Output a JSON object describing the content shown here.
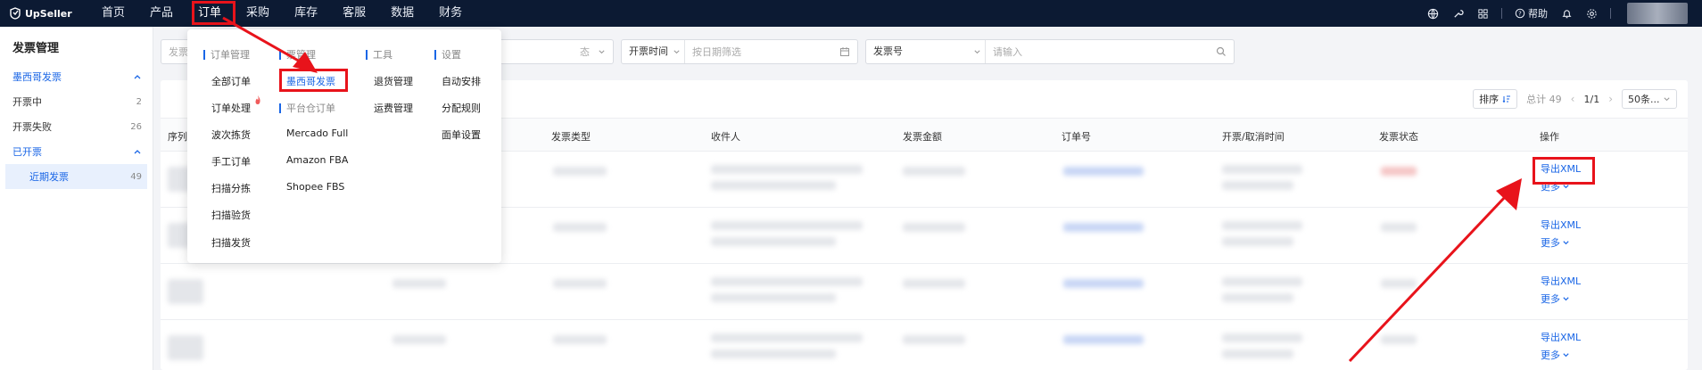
{
  "app": {
    "brand": "UpSeller"
  },
  "nav": {
    "items": [
      "首页",
      "产品",
      "订单",
      "采购",
      "库存",
      "客服",
      "数据",
      "财务"
    ],
    "active": "订单",
    "help": "帮助"
  },
  "sidebar": {
    "title": "发票管理",
    "group1": {
      "label": "墨西哥发票"
    },
    "items": [
      {
        "label": "开票中",
        "count": "2"
      },
      {
        "label": "开票失败",
        "count": "26"
      }
    ],
    "group2": {
      "label": "已开票"
    },
    "sub": {
      "label": "近期发票",
      "count": "49"
    }
  },
  "filters": {
    "box1": "发票",
    "box2_suffix": "态",
    "time_label": "开票时间",
    "date_placeholder": "按日期筛选",
    "invoice_label": "发票号",
    "search_placeholder": "请输入"
  },
  "toolbar": {
    "sort": "排序",
    "total": "总计 49",
    "page": "1/1",
    "per_page": "50条..."
  },
  "table": {
    "headers": {
      "seq": "序列",
      "type": "发票类型",
      "recipient": "收件人",
      "amount": "发票金额",
      "order": "订单号",
      "time": "开票/取消时间",
      "status": "发票状态",
      "ops": "操作"
    },
    "rows": [
      {
        "export": "导出XML",
        "more": "更多"
      },
      {
        "export": "导出XML",
        "more": "更多"
      },
      {
        "export": "导出XML",
        "more": "更多"
      },
      {
        "export": "导出XML",
        "more": "更多"
      }
    ]
  },
  "menu": {
    "col1": {
      "head": "订单管理",
      "items": [
        "全部订单",
        "订单处理",
        "波次拣货",
        "手工订单",
        "扫描分拣",
        "扫描验货",
        "扫描发货"
      ]
    },
    "col2": {
      "head": "票管理",
      "items": [
        "墨西哥发票"
      ],
      "head2": "平台仓订单",
      "items2": [
        "Mercado Full",
        "Amazon FBA",
        "Shopee FBS"
      ]
    },
    "col3": {
      "head": "工具",
      "items": [
        "退货管理",
        "运费管理"
      ]
    },
    "col4": {
      "head": "设置",
      "items": [
        "自动安排",
        "分配规则",
        "面单设置"
      ]
    }
  },
  "colors": {
    "accent": "#1a66e6",
    "nav_bg": "#0c1a33",
    "annotation": "#e8131b"
  }
}
